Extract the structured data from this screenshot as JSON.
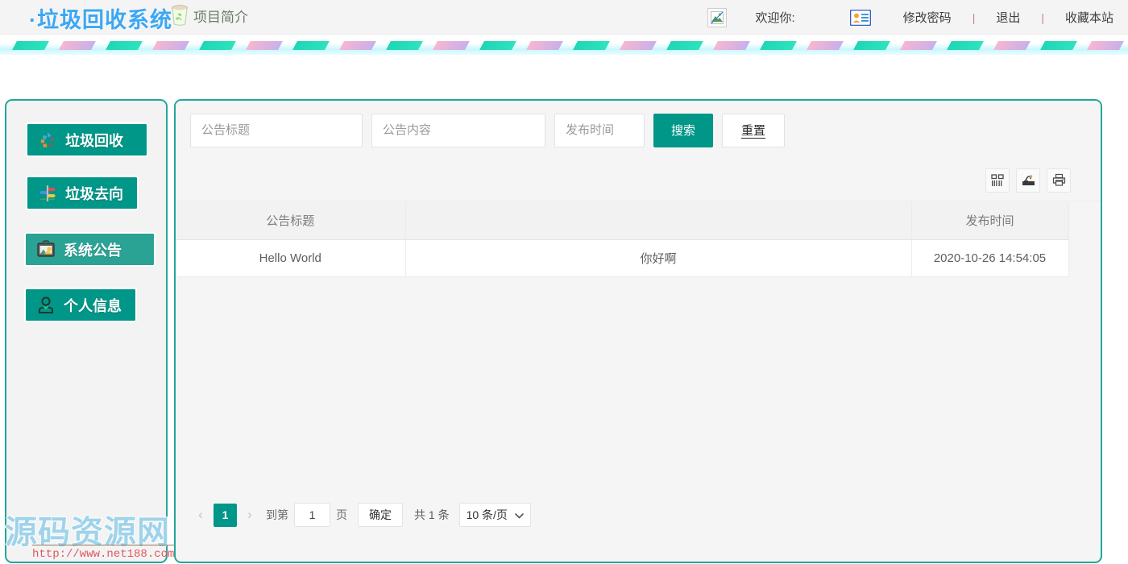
{
  "header": {
    "brand": "·垃圾回收系统",
    "intro_label": "项目简介",
    "bin_icon": "trash-bin-icon",
    "broken_image_icon": "broken-image-icon",
    "welcome_label": "欢迎你:",
    "idcard_icon": "id-card-icon",
    "links": [
      {
        "label": "修改密码"
      },
      {
        "label": "退出"
      },
      {
        "label": "收藏本站"
      }
    ],
    "separator": "|"
  },
  "stripe": {
    "colors": {
      "teal": "#2ee3bd",
      "pink": "#f8b6cf",
      "band_bg": "#c9f7fb"
    },
    "count": 24
  },
  "sidebar": {
    "items": [
      {
        "label": "垃圾回收",
        "icon": "recycle-icon",
        "active": false
      },
      {
        "label": "垃圾去向",
        "icon": "signpost-icon",
        "active": false
      },
      {
        "label": "系统公告",
        "icon": "announcement-board-icon",
        "active": true
      },
      {
        "label": "个人信息",
        "icon": "person-icon",
        "active": false
      }
    ]
  },
  "search": {
    "title_placeholder": "公告标题",
    "title_value": "",
    "content_placeholder": "公告内容",
    "content_value": "",
    "time_placeholder": "发布时间",
    "time_value": "",
    "search_label": "搜索",
    "reset_label": "重置"
  },
  "toolbar": {
    "icons": [
      {
        "name": "columns-icon"
      },
      {
        "name": "export-icon"
      },
      {
        "name": "print-icon"
      }
    ]
  },
  "table": {
    "columns": [
      "公告标题",
      "",
      "发布时间",
      ""
    ],
    "rows": [
      {
        "title": "Hello World",
        "content": "你好啊",
        "time": "2020-10-26 14:54:05",
        "extra": ""
      }
    ]
  },
  "pagination": {
    "prev_icon": "chevron-left-icon",
    "next_icon": "chevron-right-icon",
    "current_page": "1",
    "goto_label": "到第",
    "goto_value": "1",
    "page_unit": "页",
    "confirm_label": "确定",
    "total_label": "共 1 条",
    "page_size_label": "10 条/页",
    "page_size_icon": "chevron-down-icon"
  },
  "watermark": {
    "text": "源码资源网",
    "url": "http://www.net188.com"
  },
  "colors": {
    "accent": "#009688",
    "accent_active": "#2aa294",
    "panel_border": "#22a79a",
    "brand": "#3ba7f4",
    "watermark": "#9fd3ea"
  }
}
